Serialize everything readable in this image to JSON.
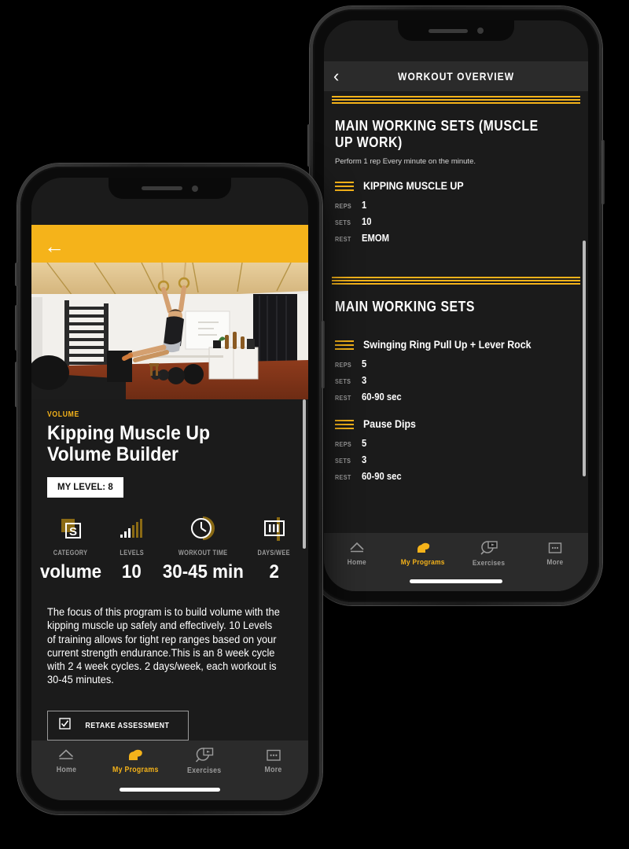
{
  "theme": {
    "accent": "#f5b31a",
    "bg": "#1b1b1b",
    "bar": "#2b2b2b",
    "muted": "#9a9a9a"
  },
  "back_phone": {
    "navbar": {
      "title": "WORKOUT OVERVIEW",
      "back_icon": "chevron-left-icon"
    },
    "sections": [
      {
        "title": "MAIN WORKING SETS (MUSCLE UP WORK)",
        "subtitle": "Perform 1 rep Every minute on the minute.",
        "exercises": [
          {
            "name": "KIPPING MUSCLE UP",
            "fields": [
              {
                "label": "REPS",
                "value": "1"
              },
              {
                "label": "SETS",
                "value": "10"
              },
              {
                "label": "REST",
                "value": "EMOM"
              }
            ]
          }
        ]
      },
      {
        "title": "MAIN WORKING SETS",
        "subtitle": "",
        "exercises": [
          {
            "name": "Swinging Ring Pull Up + Lever Rock",
            "fields": [
              {
                "label": "REPS",
                "value": "5"
              },
              {
                "label": "SETS",
                "value": "3"
              },
              {
                "label": "REST",
                "value": "60-90 sec"
              }
            ]
          },
          {
            "name": "Pause Dips",
            "fields": [
              {
                "label": "REPS",
                "value": "5"
              },
              {
                "label": "SETS",
                "value": "3"
              },
              {
                "label": "REST",
                "value": "60-90 sec"
              }
            ]
          }
        ]
      }
    ],
    "tabs": [
      {
        "label": "Home",
        "icon": "home-icon",
        "active": false
      },
      {
        "label": "My Programs",
        "icon": "bicep-icon",
        "active": true
      },
      {
        "label": "Exercises",
        "icon": "exercise-search-icon",
        "active": false
      },
      {
        "label": "More",
        "icon": "more-dots-icon",
        "active": false
      }
    ]
  },
  "front_phone": {
    "hero": {
      "back_icon": "arrow-left-icon",
      "photo_alt": "athlete-on-rings-photo"
    },
    "category_label": "VOLUME",
    "title": "Kipping Muscle Up Volume Builder",
    "level_chip": "MY LEVEL: 8",
    "stats": [
      {
        "icon": "category-badge-icon",
        "label": "CATEGORY",
        "value": "volume"
      },
      {
        "icon": "levels-bars-icon",
        "label": "LEVELS",
        "value": "10"
      },
      {
        "icon": "clock-icon",
        "label": "WORKOUT TIME",
        "value": "30-45 min"
      },
      {
        "icon": "calendar-days-icon",
        "label": "DAYS/WEE",
        "value": "2"
      }
    ],
    "description": "The focus of this program is to build volume with the kipping muscle up safely and effectively. 10 Levels of training allows for tight rep ranges based on your current strength endurance.This is an 8 week cycle with 2 4 week cycles. 2 days/week, each workout is 30-45 minutes.",
    "retake_button": {
      "label": "RETAKE ASSESSMENT",
      "icon": "checkbox-check-icon"
    },
    "tabs": [
      {
        "label": "Home",
        "icon": "home-icon",
        "active": false
      },
      {
        "label": "My Programs",
        "icon": "bicep-icon",
        "active": true
      },
      {
        "label": "Exercises",
        "icon": "exercise-search-icon",
        "active": false
      },
      {
        "label": "More",
        "icon": "more-dots-icon",
        "active": false
      }
    ]
  }
}
